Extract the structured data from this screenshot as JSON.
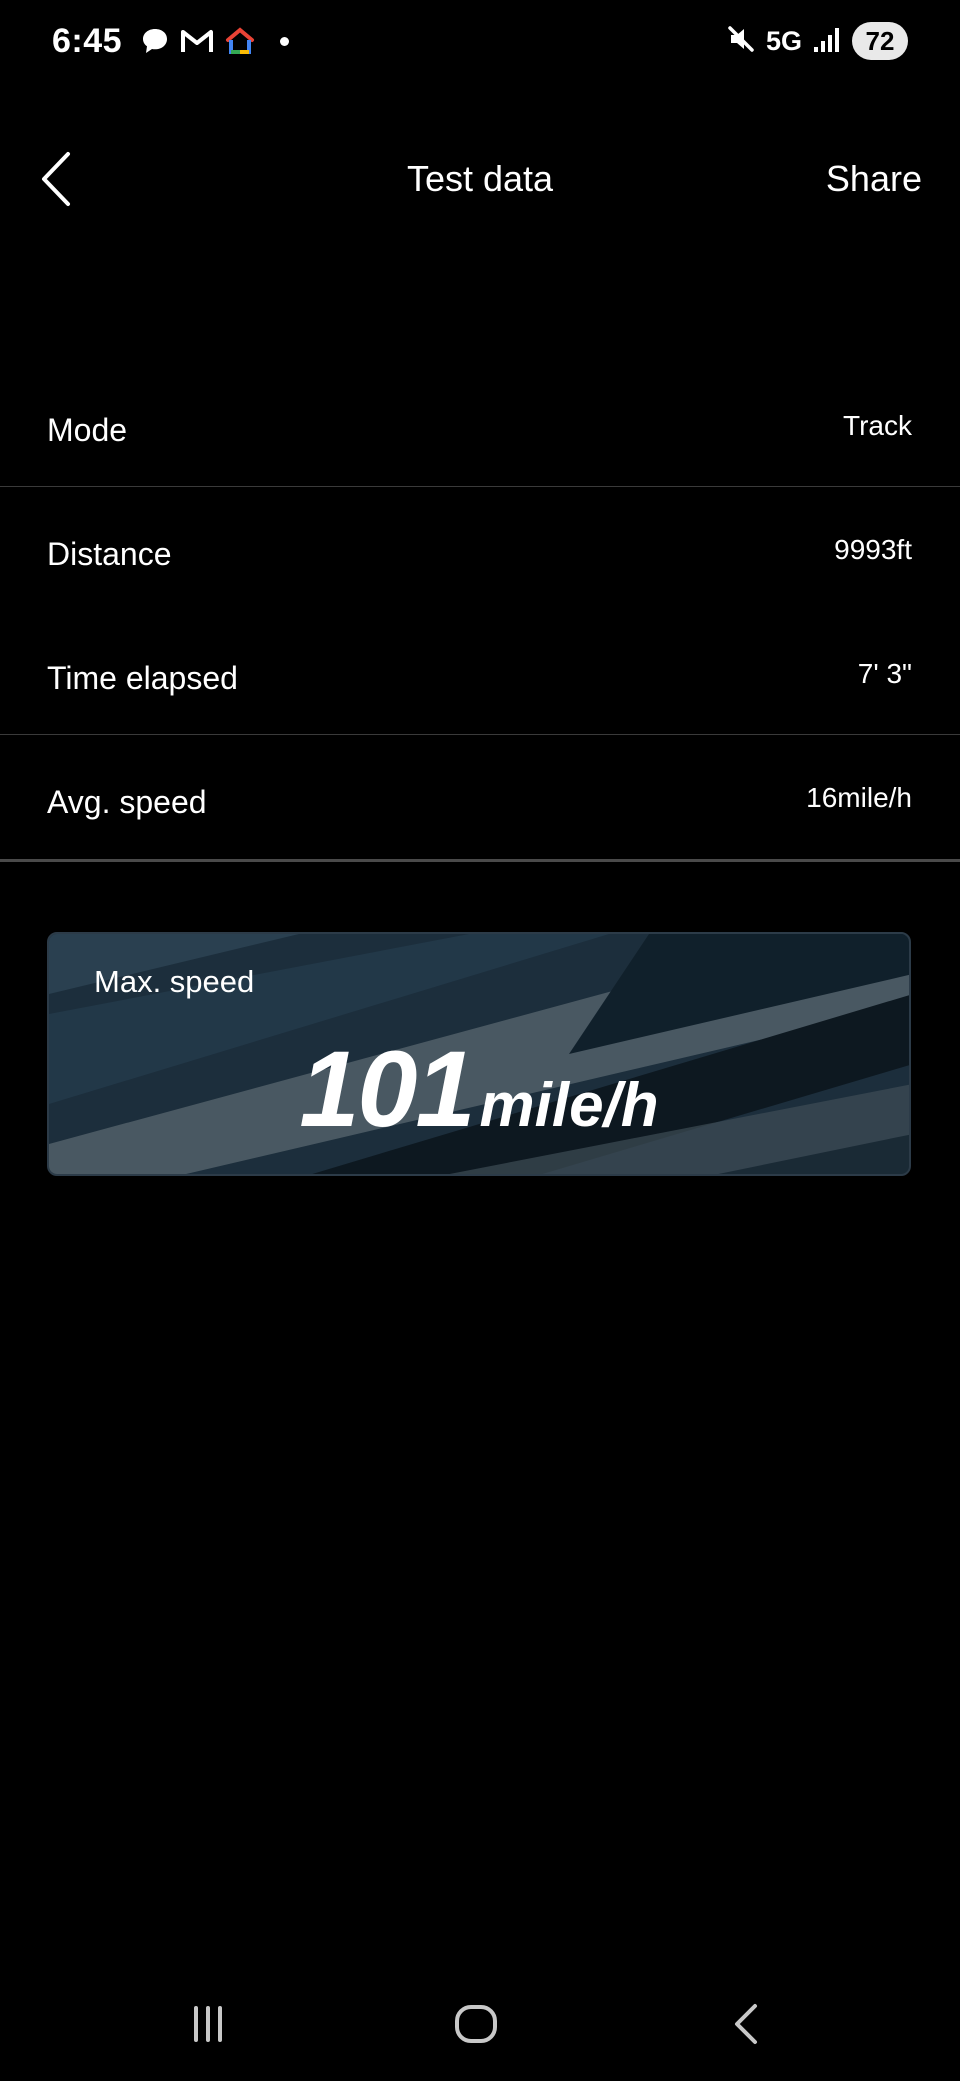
{
  "status_bar": {
    "time": "6:45",
    "network": "5G",
    "battery": "72"
  },
  "header": {
    "title": "Test data",
    "share_label": "Share"
  },
  "rows": [
    {
      "label": "Mode",
      "value": "Track"
    },
    {
      "label": "Distance",
      "value": "9993ft"
    },
    {
      "label": "Time elapsed",
      "value": "7' 3\""
    },
    {
      "label": "Avg. speed",
      "value": "16mile/h"
    }
  ],
  "max_speed": {
    "label": "Max. speed",
    "value": "101",
    "unit": "mile/h"
  },
  "colors": {
    "background": "#000000",
    "divider": "#3a3a3a",
    "card": "#1a2b38"
  }
}
